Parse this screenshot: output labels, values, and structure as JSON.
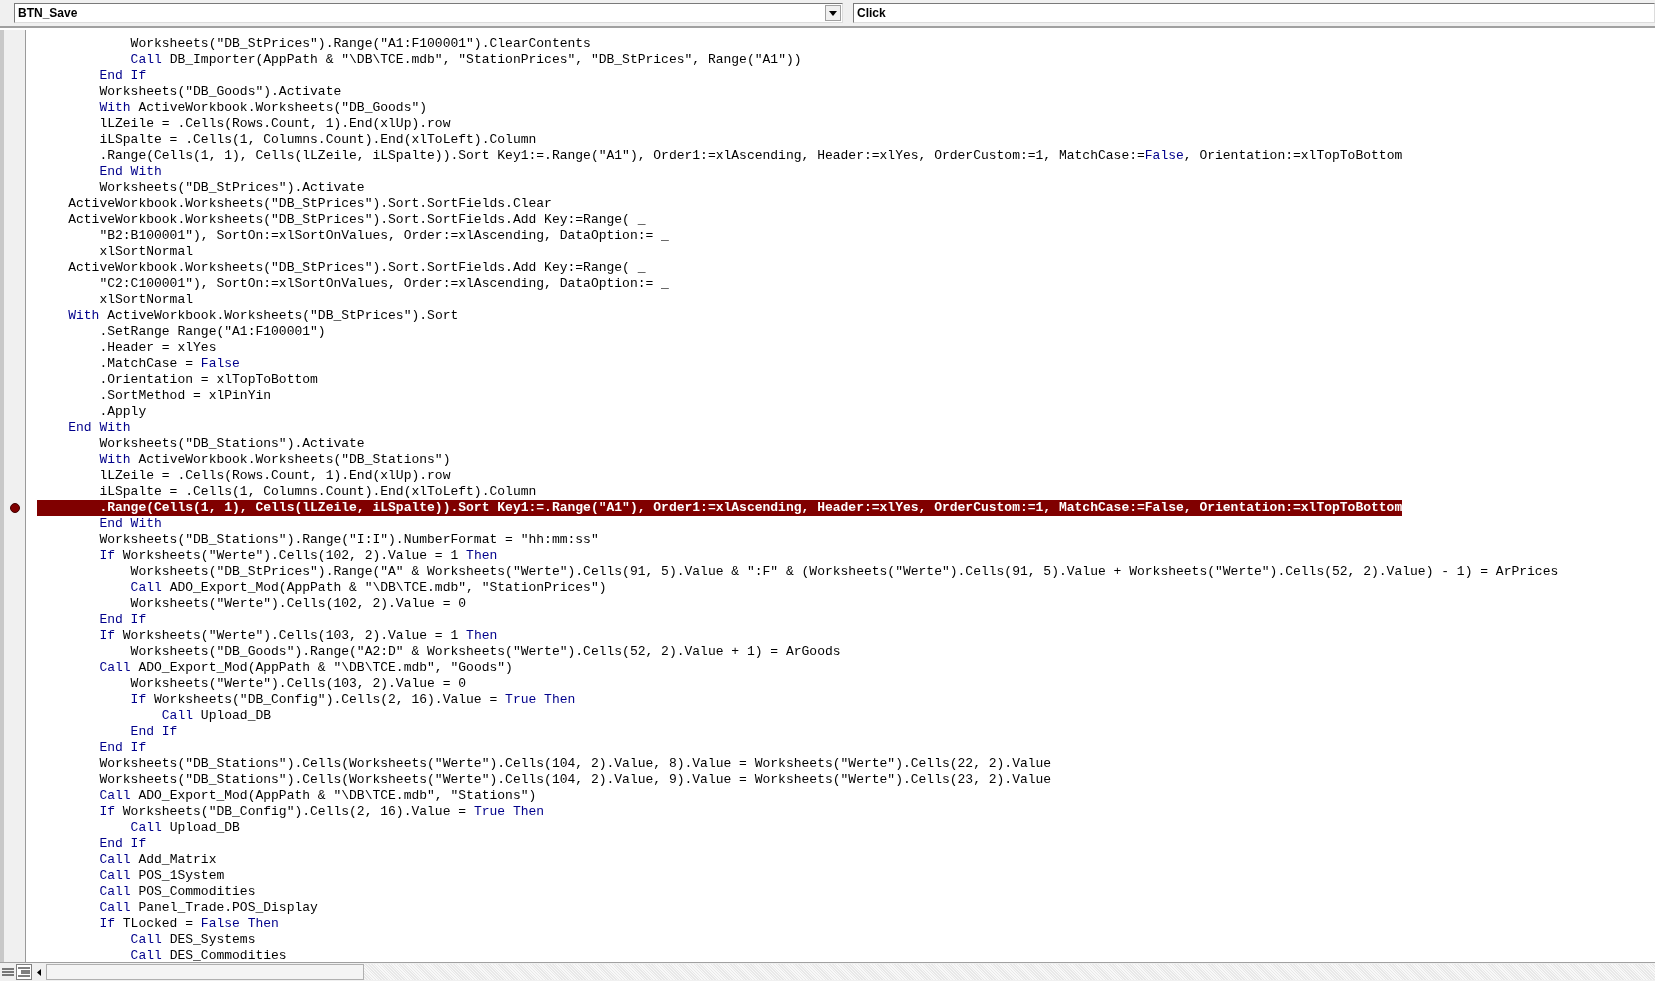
{
  "object_dropdown": {
    "value": "BTN_Save"
  },
  "procedure_dropdown": {
    "value": "Click"
  },
  "code_lines": [
    {
      "breakpoint": false,
      "tokens": [
        {
          "kind": "code",
          "text": "            Worksheets(\"DB_StPrices\").Range(\"A1:F100001\").ClearContents"
        }
      ]
    },
    {
      "breakpoint": false,
      "tokens": [
        {
          "kind": "keyword",
          "text": "            Call"
        },
        {
          "kind": "code",
          "text": " DB_Importer(AppPath & \"\\DB\\TCE.mdb\", \"StationPrices\", \"DB_StPrices\", Range(\"A1\"))"
        }
      ]
    },
    {
      "breakpoint": false,
      "tokens": [
        {
          "kind": "keyword",
          "text": "        End If"
        }
      ]
    },
    {
      "breakpoint": false,
      "tokens": [
        {
          "kind": "code",
          "text": "        Worksheets(\"DB_Goods\").Activate"
        }
      ]
    },
    {
      "breakpoint": false,
      "tokens": [
        {
          "kind": "keyword",
          "text": "        With"
        },
        {
          "kind": "code",
          "text": " ActiveWorkbook.Worksheets(\"DB_Goods\")"
        }
      ]
    },
    {
      "breakpoint": false,
      "tokens": [
        {
          "kind": "code",
          "text": "        lLZeile = .Cells(Rows.Count, 1).End(xlUp).row"
        }
      ]
    },
    {
      "breakpoint": false,
      "tokens": [
        {
          "kind": "code",
          "text": "        iLSpalte = .Cells(1, Columns.Count).End(xlToLeft).Column"
        }
      ]
    },
    {
      "breakpoint": false,
      "tokens": [
        {
          "kind": "code",
          "text": "        .Range(Cells(1, 1), Cells(lLZeile, iLSpalte)).Sort Key1:=.Range(\"A1\"), Order1:=xlAscending, Header:=xlYes, OrderCustom:=1, MatchCase:="
        },
        {
          "kind": "keyword",
          "text": "False"
        },
        {
          "kind": "code",
          "text": ", Orientation:=xlTopToBottom"
        }
      ]
    },
    {
      "breakpoint": false,
      "tokens": [
        {
          "kind": "keyword",
          "text": "        End With"
        }
      ]
    },
    {
      "breakpoint": false,
      "tokens": [
        {
          "kind": "code",
          "text": "        Worksheets(\"DB_StPrices\").Activate"
        }
      ]
    },
    {
      "breakpoint": false,
      "tokens": [
        {
          "kind": "code",
          "text": "    ActiveWorkbook.Worksheets(\"DB_StPrices\").Sort.SortFields.Clear"
        }
      ]
    },
    {
      "breakpoint": false,
      "tokens": [
        {
          "kind": "code",
          "text": "    ActiveWorkbook.Worksheets(\"DB_StPrices\").Sort.SortFields.Add Key:=Range( _"
        }
      ]
    },
    {
      "breakpoint": false,
      "tokens": [
        {
          "kind": "code",
          "text": "        \"B2:B100001\"), SortOn:=xlSortOnValues, Order:=xlAscending, DataOption:= _"
        }
      ]
    },
    {
      "breakpoint": false,
      "tokens": [
        {
          "kind": "code",
          "text": "        xlSortNormal"
        }
      ]
    },
    {
      "breakpoint": false,
      "tokens": [
        {
          "kind": "code",
          "text": "    ActiveWorkbook.Worksheets(\"DB_StPrices\").Sort.SortFields.Add Key:=Range( _"
        }
      ]
    },
    {
      "breakpoint": false,
      "tokens": [
        {
          "kind": "code",
          "text": "        \"C2:C100001\"), SortOn:=xlSortOnValues, Order:=xlAscending, DataOption:= _"
        }
      ]
    },
    {
      "breakpoint": false,
      "tokens": [
        {
          "kind": "code",
          "text": "        xlSortNormal"
        }
      ]
    },
    {
      "breakpoint": false,
      "tokens": [
        {
          "kind": "keyword",
          "text": "    With"
        },
        {
          "kind": "code",
          "text": " ActiveWorkbook.Worksheets(\"DB_StPrices\").Sort"
        }
      ]
    },
    {
      "breakpoint": false,
      "tokens": [
        {
          "kind": "code",
          "text": "        .SetRange Range(\"A1:F100001\")"
        }
      ]
    },
    {
      "breakpoint": false,
      "tokens": [
        {
          "kind": "code",
          "text": "        .Header = xlYes"
        }
      ]
    },
    {
      "breakpoint": false,
      "tokens": [
        {
          "kind": "code",
          "text": "        .MatchCase = "
        },
        {
          "kind": "keyword",
          "text": "False"
        }
      ]
    },
    {
      "breakpoint": false,
      "tokens": [
        {
          "kind": "code",
          "text": "        .Orientation = xlTopToBottom"
        }
      ]
    },
    {
      "breakpoint": false,
      "tokens": [
        {
          "kind": "code",
          "text": "        .SortMethod = xlPinYin"
        }
      ]
    },
    {
      "breakpoint": false,
      "tokens": [
        {
          "kind": "code",
          "text": "        .Apply"
        }
      ]
    },
    {
      "breakpoint": false,
      "tokens": [
        {
          "kind": "keyword",
          "text": "    End With"
        }
      ]
    },
    {
      "breakpoint": false,
      "tokens": [
        {
          "kind": "code",
          "text": "        Worksheets(\"DB_Stations\").Activate"
        }
      ]
    },
    {
      "breakpoint": false,
      "tokens": [
        {
          "kind": "keyword",
          "text": "        With"
        },
        {
          "kind": "code",
          "text": " ActiveWorkbook.Worksheets(\"DB_Stations\")"
        }
      ]
    },
    {
      "breakpoint": false,
      "tokens": [
        {
          "kind": "code",
          "text": "        lLZeile = .Cells(Rows.Count, 1).End(xlUp).row"
        }
      ]
    },
    {
      "breakpoint": false,
      "tokens": [
        {
          "kind": "code",
          "text": "        iLSpalte = .Cells(1, Columns.Count).End(xlToLeft).Column"
        }
      ]
    },
    {
      "breakpoint": true,
      "tokens": [
        {
          "kind": "code",
          "text": "        .Range(Cells(1, 1), Cells(lLZeile, iLSpalte)).Sort Key1:=.Range(\"A1\"), Order1:=xlAscending, Header:=xlYes, OrderCustom:=1, MatchCase:=False, Orientation:=xlTopToBottom"
        }
      ]
    },
    {
      "breakpoint": false,
      "tokens": [
        {
          "kind": "keyword",
          "text": "        End With"
        }
      ]
    },
    {
      "breakpoint": false,
      "tokens": [
        {
          "kind": "code",
          "text": "        Worksheets(\"DB_Stations\").Range(\"I:I\").NumberFormat = \"hh:mm:ss\""
        }
      ]
    },
    {
      "breakpoint": false,
      "tokens": [
        {
          "kind": "keyword",
          "text": "        If"
        },
        {
          "kind": "code",
          "text": " Worksheets(\"Werte\").Cells(102, 2).Value = 1 "
        },
        {
          "kind": "keyword",
          "text": "Then"
        }
      ]
    },
    {
      "breakpoint": false,
      "tokens": [
        {
          "kind": "code",
          "text": "            Worksheets(\"DB_StPrices\").Range(\"A\" & Worksheets(\"Werte\").Cells(91, 5).Value & \":F\" & (Worksheets(\"Werte\").Cells(91, 5).Value + Worksheets(\"Werte\").Cells(52, 2).Value) - 1) = ArPrices"
        }
      ]
    },
    {
      "breakpoint": false,
      "tokens": [
        {
          "kind": "keyword",
          "text": "            Call"
        },
        {
          "kind": "code",
          "text": " ADO_Export_Mod(AppPath & \"\\DB\\TCE.mdb\", \"StationPrices\")"
        }
      ]
    },
    {
      "breakpoint": false,
      "tokens": [
        {
          "kind": "code",
          "text": "            Worksheets(\"Werte\").Cells(102, 2).Value = 0"
        }
      ]
    },
    {
      "breakpoint": false,
      "tokens": [
        {
          "kind": "keyword",
          "text": "        End If"
        }
      ]
    },
    {
      "breakpoint": false,
      "tokens": [
        {
          "kind": "keyword",
          "text": "        If"
        },
        {
          "kind": "code",
          "text": " Worksheets(\"Werte\").Cells(103, 2).Value = 1 "
        },
        {
          "kind": "keyword",
          "text": "Then"
        }
      ]
    },
    {
      "breakpoint": false,
      "tokens": [
        {
          "kind": "code",
          "text": "            Worksheets(\"DB_Goods\").Range(\"A2:D\" & Worksheets(\"Werte\").Cells(52, 2).Value + 1) = ArGoods"
        }
      ]
    },
    {
      "breakpoint": false,
      "tokens": [
        {
          "kind": "keyword",
          "text": "        Call"
        },
        {
          "kind": "code",
          "text": " ADO_Export_Mod(AppPath & \"\\DB\\TCE.mdb\", \"Goods\")"
        }
      ]
    },
    {
      "breakpoint": false,
      "tokens": [
        {
          "kind": "code",
          "text": "            Worksheets(\"Werte\").Cells(103, 2).Value = 0"
        }
      ]
    },
    {
      "breakpoint": false,
      "tokens": [
        {
          "kind": "keyword",
          "text": "            If"
        },
        {
          "kind": "code",
          "text": " Worksheets(\"DB_Config\").Cells(2, 16).Value = "
        },
        {
          "kind": "keyword",
          "text": "True Then"
        }
      ]
    },
    {
      "breakpoint": false,
      "tokens": [
        {
          "kind": "keyword",
          "text": "                Call"
        },
        {
          "kind": "code",
          "text": " Upload_DB"
        }
      ]
    },
    {
      "breakpoint": false,
      "tokens": [
        {
          "kind": "keyword",
          "text": "            End If"
        }
      ]
    },
    {
      "breakpoint": false,
      "tokens": [
        {
          "kind": "keyword",
          "text": "        End If"
        }
      ]
    },
    {
      "breakpoint": false,
      "tokens": [
        {
          "kind": "code",
          "text": "        Worksheets(\"DB_Stations\").Cells(Worksheets(\"Werte\").Cells(104, 2).Value, 8).Value = Worksheets(\"Werte\").Cells(22, 2).Value"
        }
      ]
    },
    {
      "breakpoint": false,
      "tokens": [
        {
          "kind": "code",
          "text": "        Worksheets(\"DB_Stations\").Cells(Worksheets(\"Werte\").Cells(104, 2).Value, 9).Value = Worksheets(\"Werte\").Cells(23, 2).Value"
        }
      ]
    },
    {
      "breakpoint": false,
      "tokens": [
        {
          "kind": "keyword",
          "text": "        Call"
        },
        {
          "kind": "code",
          "text": " ADO_Export_Mod(AppPath & \"\\DB\\TCE.mdb\", \"Stations\")"
        }
      ]
    },
    {
      "breakpoint": false,
      "tokens": [
        {
          "kind": "keyword",
          "text": "        If"
        },
        {
          "kind": "code",
          "text": " Worksheets(\"DB_Config\").Cells(2, 16).Value = "
        },
        {
          "kind": "keyword",
          "text": "True Then"
        }
      ]
    },
    {
      "breakpoint": false,
      "tokens": [
        {
          "kind": "keyword",
          "text": "            Call"
        },
        {
          "kind": "code",
          "text": " Upload_DB"
        }
      ]
    },
    {
      "breakpoint": false,
      "tokens": [
        {
          "kind": "keyword",
          "text": "        End If"
        }
      ]
    },
    {
      "breakpoint": false,
      "tokens": [
        {
          "kind": "keyword",
          "text": "        Call"
        },
        {
          "kind": "code",
          "text": " Add_Matrix"
        }
      ]
    },
    {
      "breakpoint": false,
      "tokens": [
        {
          "kind": "keyword",
          "text": "        Call"
        },
        {
          "kind": "code",
          "text": " POS_1System"
        }
      ]
    },
    {
      "breakpoint": false,
      "tokens": [
        {
          "kind": "keyword",
          "text": "        Call"
        },
        {
          "kind": "code",
          "text": " POS_Commodities"
        }
      ]
    },
    {
      "breakpoint": false,
      "tokens": [
        {
          "kind": "keyword",
          "text": "        Call"
        },
        {
          "kind": "code",
          "text": " Panel_Trade.POS_Display"
        }
      ]
    },
    {
      "breakpoint": false,
      "tokens": [
        {
          "kind": "keyword",
          "text": "        If"
        },
        {
          "kind": "code",
          "text": " TLocked = "
        },
        {
          "kind": "keyword",
          "text": "False Then"
        }
      ]
    },
    {
      "breakpoint": false,
      "tokens": [
        {
          "kind": "keyword",
          "text": "            Call"
        },
        {
          "kind": "code",
          "text": " DES_Systems"
        }
      ]
    },
    {
      "breakpoint": false,
      "tokens": [
        {
          "kind": "keyword",
          "text": "            Call"
        },
        {
          "kind": "code",
          "text": " DES_Commodities"
        }
      ]
    }
  ]
}
